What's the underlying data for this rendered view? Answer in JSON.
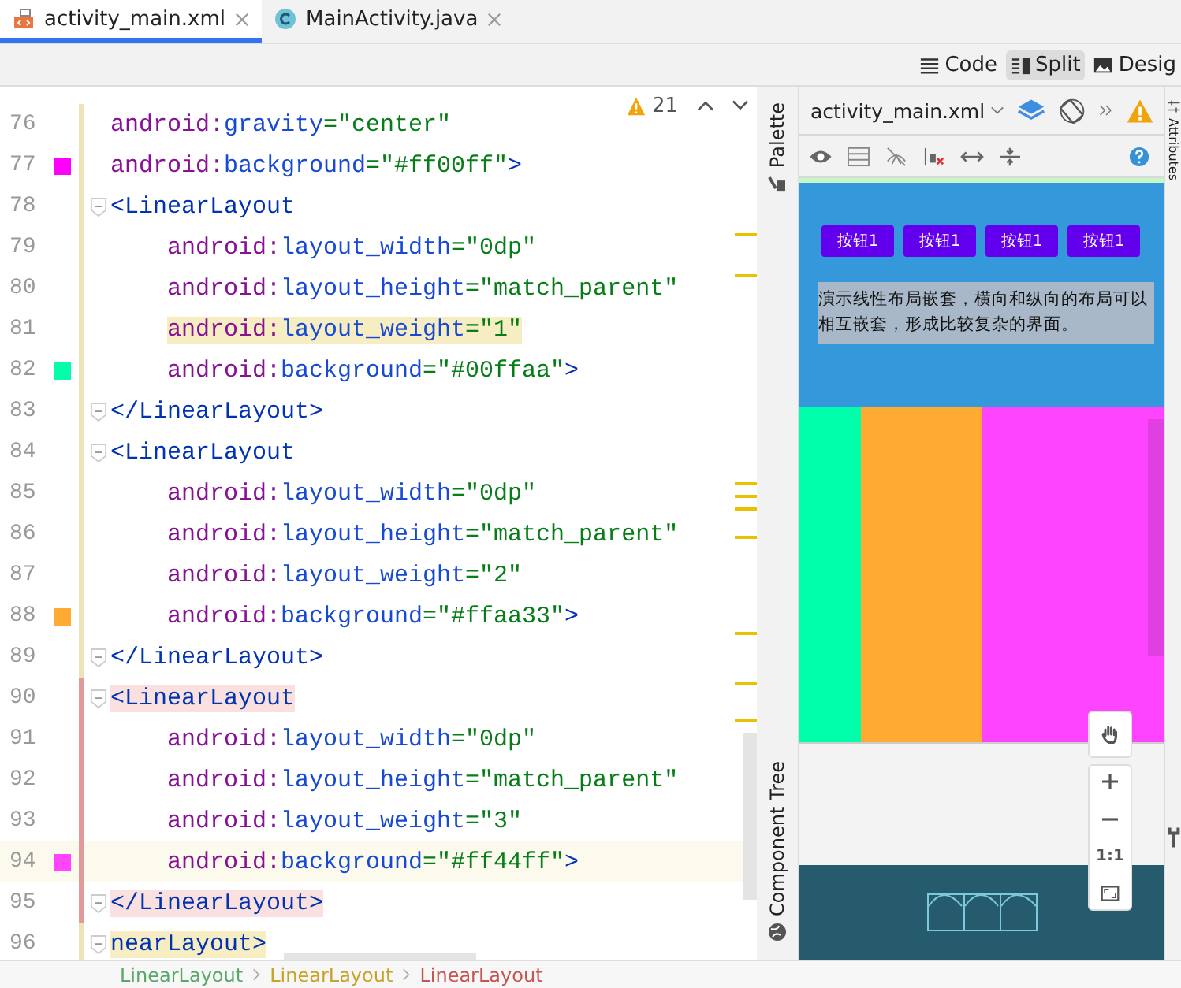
{
  "tabs": [
    {
      "label": "activity_main.xml",
      "selected": true
    },
    {
      "label": "MainActivity.java",
      "selected": false
    }
  ],
  "view_modes": [
    {
      "label": "Code",
      "selected": false
    },
    {
      "label": "Split",
      "selected": true
    },
    {
      "label": "Desig",
      "selected": false
    }
  ],
  "editor": {
    "warning_count": "21",
    "lines": [
      {
        "number": "76",
        "kind": "attr",
        "prefix": "android:",
        "name": "gravity",
        "value": "=\"center\"",
        "fold": false,
        "current": false,
        "match": false,
        "error": false,
        "error_block": false
      },
      {
        "number": "77",
        "kind": "attr",
        "prefix": "android:",
        "name": "background",
        "value": "=\"#ff00ff\"",
        "tail": ">",
        "color": "#ff00ff",
        "fold": false,
        "current": false,
        "match": false,
        "error": false,
        "error_block": false
      },
      {
        "number": "78",
        "kind": "tag",
        "text": "<LinearLayout",
        "fold": true,
        "current": false,
        "match": false,
        "error": false,
        "error_block": false
      },
      {
        "number": "79",
        "kind": "nested_attr",
        "prefix": "android:",
        "name": "layout_width",
        "value": "=\"0dp\"",
        "fold": false,
        "current": false,
        "match": false,
        "error": false,
        "error_block": false
      },
      {
        "number": "80",
        "kind": "nested_attr",
        "prefix": "android:",
        "name": "layout_height",
        "value": "=\"match_parent\"",
        "fold": false,
        "current": false,
        "match": false,
        "error": false,
        "error_block": false
      },
      {
        "number": "81",
        "kind": "nested_attr",
        "prefix": "android:",
        "name": "layout_weight",
        "value": "=\"1\"",
        "fold": false,
        "current": false,
        "match": true,
        "error": false,
        "error_block": false
      },
      {
        "number": "82",
        "kind": "nested_attr",
        "prefix": "android:",
        "name": "background",
        "value": "=\"#00ffaa\"",
        "tail": ">",
        "color": "#00ffaa",
        "fold": false,
        "current": false,
        "match": false,
        "error": false,
        "error_block": false
      },
      {
        "number": "83",
        "kind": "tag",
        "text": "</LinearLayout>",
        "fold": true,
        "current": false,
        "match": false,
        "error": false,
        "error_block": false
      },
      {
        "number": "84",
        "kind": "tag",
        "text": "<LinearLayout",
        "fold": true,
        "current": false,
        "match": false,
        "error": false,
        "error_block": false
      },
      {
        "number": "85",
        "kind": "nested_attr",
        "prefix": "android:",
        "name": "layout_width",
        "value": "=\"0dp\"",
        "fold": false,
        "current": false,
        "match": false,
        "error": false,
        "error_block": false
      },
      {
        "number": "86",
        "kind": "nested_attr",
        "prefix": "android:",
        "name": "layout_height",
        "value": "=\"match_parent\"",
        "fold": false,
        "current": false,
        "match": false,
        "error": false,
        "error_block": false
      },
      {
        "number": "87",
        "kind": "nested_attr",
        "prefix": "android:",
        "name": "layout_weight",
        "value": "=\"2\"",
        "fold": false,
        "current": false,
        "match": false,
        "error": false,
        "error_block": false
      },
      {
        "number": "88",
        "kind": "nested_attr",
        "prefix": "android:",
        "name": "background",
        "value": "=\"#ffaa33\"",
        "tail": ">",
        "color": "#ffaa33",
        "fold": false,
        "current": false,
        "match": false,
        "error": false,
        "error_block": false
      },
      {
        "number": "89",
        "kind": "tag",
        "text": "</LinearLayout>",
        "fold": true,
        "current": false,
        "match": false,
        "error": false,
        "error_block": false
      },
      {
        "number": "90",
        "kind": "tag",
        "text": "<LinearLayout",
        "fold": true,
        "current": false,
        "match": false,
        "error": true,
        "error_block": true
      },
      {
        "number": "91",
        "kind": "nested_attr",
        "prefix": "android:",
        "name": "layout_width",
        "value": "=\"0dp\"",
        "fold": false,
        "current": false,
        "match": false,
        "error": false,
        "error_block": true
      },
      {
        "number": "92",
        "kind": "nested_attr",
        "prefix": "android:",
        "name": "layout_height",
        "value": "=\"match_parent\"",
        "fold": false,
        "current": false,
        "match": false,
        "error": false,
        "error_block": true
      },
      {
        "number": "93",
        "kind": "nested_attr",
        "prefix": "android:",
        "name": "layout_weight",
        "value": "=\"3\"",
        "fold": false,
        "current": false,
        "match": false,
        "error": false,
        "error_block": true
      },
      {
        "number": "94",
        "kind": "nested_attr",
        "prefix": "android:",
        "name": "background",
        "value": "=\"#ff44ff\"",
        "tail": ">",
        "color": "#ff44ff",
        "fold": false,
        "current": true,
        "match": false,
        "error": false,
        "error_block": true
      },
      {
        "number": "95",
        "kind": "tag",
        "text": "</LinearLayout>",
        "fold": true,
        "current": false,
        "match": false,
        "error": true,
        "error_block": true
      },
      {
        "number": "96",
        "kind": "tag",
        "text": "nearLayout>",
        "fold": true,
        "current": false,
        "match": true,
        "error": false,
        "error_block": false
      }
    ]
  },
  "design": {
    "file": "activity_main.xml",
    "side_labels": [
      "Palette",
      "Component Tree"
    ],
    "attributes_label": "Attributes",
    "preview": {
      "buttons": [
        "按钮1",
        "按钮1",
        "按钮1",
        "按钮1"
      ],
      "text": "演示线性布局嵌套，横向和纵向的布局可以相互嵌套，形成比较复杂的界面。",
      "columns": [
        {
          "color": "#00ffaa"
        },
        {
          "color": "#ffaa33"
        },
        {
          "color": "#ff44ff"
        }
      ]
    },
    "zoom_controls": [
      "1:1"
    ]
  },
  "breadcrumb": [
    {
      "label": "LinearLayout",
      "color": "#59a869"
    },
    {
      "label": "LinearLayout",
      "color": "#c9a227"
    },
    {
      "label": "LinearLayout",
      "color": "#c75450"
    }
  ]
}
